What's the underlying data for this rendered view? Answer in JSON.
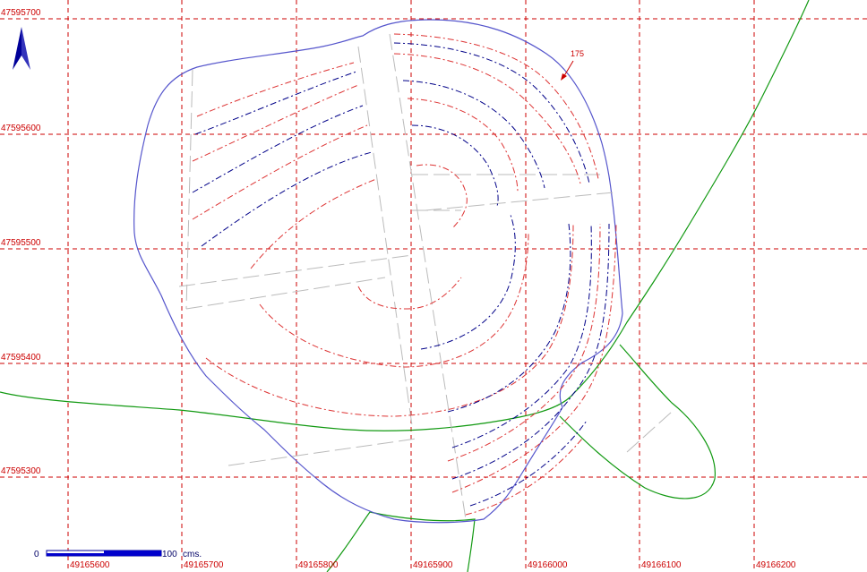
{
  "map": {
    "y_ticks": [
      "47595700",
      "47595600",
      "47595500",
      "47595400",
      "47595300"
    ],
    "x_ticks": [
      "49165600",
      "49165700",
      "49165800",
      "49165900",
      "49166000",
      "49166100",
      "49166200"
    ],
    "contour_label": "175",
    "scale_bar": {
      "start_label": "0",
      "end_label": "100",
      "unit": "cms."
    },
    "north_arrow": "north-arrow-icon",
    "colors": {
      "grid": "#cc0000",
      "boundary": "#5555cc",
      "road": "#119911",
      "contour_red": "#dd3333",
      "contour_blue": "#000088",
      "path": "#bbbbbb"
    }
  }
}
